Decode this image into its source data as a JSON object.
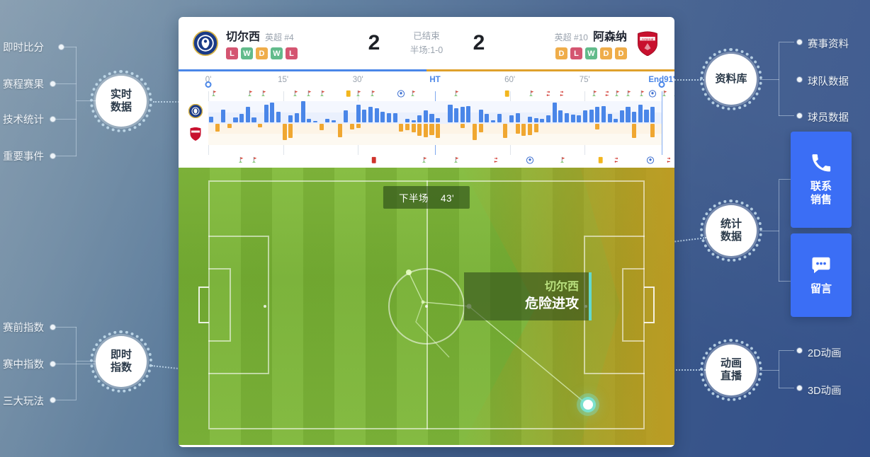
{
  "left_groups": [
    {
      "hub": [
        "实时",
        "数据"
      ],
      "leaves": [
        "即时比分",
        "赛程赛果",
        "技术统计",
        "重要事件"
      ]
    },
    {
      "hub": [
        "即时",
        "指数"
      ],
      "leaves": [
        "赛前指数",
        "赛中指数",
        "三大玩法"
      ]
    }
  ],
  "right_groups": [
    {
      "hub": [
        "资料库"
      ],
      "leaves": [
        "赛事资料",
        "球队数据",
        "球员数据"
      ]
    },
    {
      "hub": [
        "统计",
        "数据"
      ],
      "leaves": []
    },
    {
      "hub": [
        "动画",
        "直播"
      ],
      "leaves": [
        "2D动画",
        "3D动画"
      ]
    }
  ],
  "cta_buttons": [
    {
      "icon": "phone-icon",
      "label": "联系\n销售"
    },
    {
      "icon": "chat-icon",
      "label": "留言"
    }
  ],
  "cta_phone_label_l1": "联系",
  "cta_phone_label_l2": "销售",
  "cta_chat_label": "留言",
  "match": {
    "home": {
      "name": "切尔西",
      "rank": "英超 #4",
      "form": [
        "L",
        "W",
        "D",
        "W",
        "L"
      ],
      "crest": "chelsea-crest"
    },
    "away": {
      "name": "阿森纳",
      "rank": "英超 #10",
      "form": [
        "D",
        "L",
        "W",
        "D",
        "D"
      ],
      "crest": "arsenal-crest"
    },
    "home_score": "2",
    "away_score": "2",
    "status": "已结束",
    "halftime": "半场:1-0"
  },
  "timeline": {
    "ticks": [
      {
        "label": "0'",
        "pos": 0,
        "highlight": false
      },
      {
        "label": "15'",
        "pos": 16.5,
        "highlight": false
      },
      {
        "label": "30'",
        "pos": 33,
        "highlight": false
      },
      {
        "label": "HT",
        "pos": 50,
        "highlight": true
      },
      {
        "label": "60'",
        "pos": 66.5,
        "highlight": false
      },
      {
        "label": "75'",
        "pos": 83,
        "highlight": false
      },
      {
        "label": "End91'",
        "pos": 100,
        "highlight": true
      }
    ],
    "events_top": [
      {
        "pos": 1.5,
        "type": "corner"
      },
      {
        "pos": 9.5,
        "type": "corner"
      },
      {
        "pos": 12.5,
        "type": "corner"
      },
      {
        "pos": 19.5,
        "type": "corner"
      },
      {
        "pos": 22.5,
        "type": "corner"
      },
      {
        "pos": 25.5,
        "type": "corner"
      },
      {
        "pos": 31,
        "type": "yellow"
      },
      {
        "pos": 33.5,
        "type": "corner"
      },
      {
        "pos": 36.5,
        "type": "corner"
      },
      {
        "pos": 42.5,
        "type": "goal"
      },
      {
        "pos": 45.5,
        "type": "corner"
      },
      {
        "pos": 55,
        "type": "corner"
      },
      {
        "pos": 66,
        "type": "yellow"
      },
      {
        "pos": 71.5,
        "type": "corner"
      },
      {
        "pos": 75,
        "type": "sub"
      },
      {
        "pos": 78,
        "type": "sub"
      },
      {
        "pos": 85.5,
        "type": "corner"
      },
      {
        "pos": 88,
        "type": "sub"
      },
      {
        "pos": 90.5,
        "type": "corner"
      },
      {
        "pos": 93,
        "type": "corner"
      },
      {
        "pos": 96,
        "type": "corner"
      },
      {
        "pos": 98,
        "type": "goal"
      },
      {
        "pos": 101,
        "type": "corner"
      },
      {
        "pos": 103.5,
        "type": "corner"
      }
    ],
    "events_bottom": [
      {
        "pos": 7.5,
        "type": "corner"
      },
      {
        "pos": 10.5,
        "type": "corner"
      },
      {
        "pos": 36.5,
        "type": "red"
      },
      {
        "pos": 48,
        "type": "corner"
      },
      {
        "pos": 55,
        "type": "corner"
      },
      {
        "pos": 63.5,
        "type": "sub"
      },
      {
        "pos": 71,
        "type": "goal"
      },
      {
        "pos": 78.5,
        "type": "corner"
      },
      {
        "pos": 86.5,
        "type": "yellow"
      },
      {
        "pos": 90,
        "type": "sub"
      },
      {
        "pos": 97.5,
        "type": "goal"
      },
      {
        "pos": 101.5,
        "type": "sub"
      }
    ],
    "bars_home": [
      10,
      0,
      22,
      0,
      8,
      14,
      26,
      8,
      0,
      30,
      34,
      18,
      0,
      12,
      16,
      36,
      6,
      3,
      0,
      6,
      4,
      0,
      20,
      0,
      30,
      22,
      26,
      24,
      18,
      16,
      16,
      0,
      6,
      4,
      12,
      20,
      14,
      7,
      0,
      30,
      24,
      26,
      28,
      0,
      22,
      14,
      4,
      14,
      0,
      12,
      16,
      0,
      10,
      7,
      6,
      12,
      34,
      20,
      16,
      13,
      12,
      20,
      22,
      26,
      28,
      14,
      6,
      20,
      26,
      18,
      30,
      22,
      26,
      0
    ],
    "bars_away": [
      0,
      14,
      0,
      8,
      0,
      0,
      0,
      0,
      6,
      0,
      0,
      0,
      30,
      26,
      0,
      0,
      0,
      0,
      12,
      0,
      0,
      24,
      0,
      10,
      8,
      0,
      0,
      0,
      0,
      0,
      0,
      14,
      12,
      16,
      22,
      24,
      20,
      26,
      0,
      0,
      0,
      8,
      0,
      30,
      16,
      0,
      0,
      0,
      26,
      0,
      18,
      22,
      20,
      16,
      0,
      0,
      0,
      0,
      0,
      0,
      0,
      0,
      0,
      10,
      0,
      0,
      0,
      0,
      0,
      26,
      0,
      0,
      24,
      0
    ]
  },
  "pitch": {
    "half_label": "下半场",
    "minute": "43'",
    "event_team": "切尔西",
    "event_text": "危险进攻"
  },
  "colors": {
    "home_bar": "#4a86e8",
    "away_bar": "#f0a731",
    "accent_blue": "#3b6ef5",
    "accent_orange": "#dfa12c",
    "marker_cyan": "#63d9cf"
  }
}
